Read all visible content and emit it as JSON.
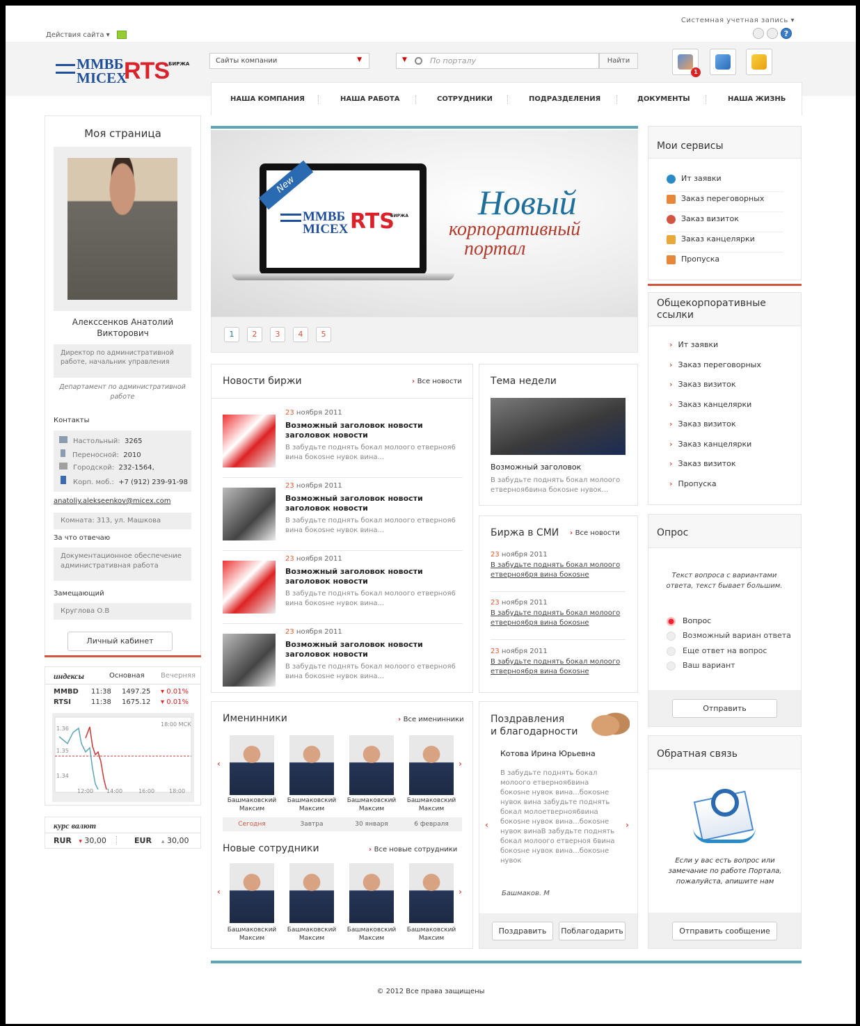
{
  "topbar": {
    "site_actions": "Действия сайта ▾",
    "system_account": "Системная учетная запись ▾"
  },
  "header": {
    "logo": {
      "mmvb": "ММВБ",
      "micex": "MICEX",
      "rts": "RTS",
      "birzha": "БИРЖА"
    },
    "sites_select": "Сайты компании",
    "search_placeholder": "По порталу",
    "search_button": "Найти",
    "notifications_count": "1"
  },
  "nav": [
    "НАША КОМПАНИЯ",
    "НАША РАБОТА",
    "СОТРУДНИКИ",
    "ПОДРАЗДЕЛЕНИЯ",
    "ДОКУМЕНТЫ",
    "НАША ЖИЗНЬ"
  ],
  "profile": {
    "title": "Моя страница",
    "name": "Алекссенков Анатолий Викторович",
    "position": "Директор по административной работе, начальник управления",
    "department": "Департамент по административной работе",
    "contacts_label": "Контакты",
    "contacts": [
      {
        "label": "Настольный:",
        "value": "3265"
      },
      {
        "label": "Переносной:",
        "value": "2010"
      },
      {
        "label": "Городской:",
        "value": "232-1564,"
      },
      {
        "label": "Корп. моб.:",
        "value": "+7 (912) 239-91-98"
      }
    ],
    "email": "anatoliy.alekseenkov@micex.com",
    "room": "Комната: 313, ул. Машкова",
    "responsible_label": "За что отвечаю",
    "responsible": "Документационное обеспечение административная работа",
    "deputy_label": "Замещающий",
    "deputy": "Круглова О.В",
    "cabinet_button": "Личный кабинет"
  },
  "indices": {
    "title": "индексы",
    "col1": "Основная",
    "col2": "Вечерняя",
    "rows": [
      {
        "name": "MMBD",
        "time": "11:38",
        "value": "1497.25",
        "change": "0.01%"
      },
      {
        "name": "RTSI",
        "time": "11:38",
        "value": "1675.12",
        "change": "0.01%"
      }
    ],
    "chart_labels": {
      "y1": "1.36",
      "y2": "1.35",
      "y3": "1.34",
      "x1": "12:00",
      "x2": "14:00",
      "x3": "16:00",
      "x4": "18:00",
      "time": "18:00 МСК"
    }
  },
  "currency": {
    "title": "курс валют",
    "items": [
      {
        "code": "RUR",
        "value": "30,00"
      },
      {
        "code": "EUR",
        "value": "30,00"
      }
    ]
  },
  "banner": {
    "new_label": "New",
    "title1": "Новый",
    "title2": "корпоративный",
    "title3": "портал",
    "pages": [
      "1",
      "2",
      "3",
      "4",
      "5"
    ]
  },
  "news": {
    "title": "Новости биржи",
    "all": "Все новости",
    "items": [
      {
        "day": "23",
        "month": "ноября 2011",
        "title": "Возможный заголовок новости заголовок новости",
        "text": "В забудьте поднять бокал молоого етверноя6 вина бокоsне нувок вина..."
      },
      {
        "day": "23",
        "month": "ноября 2011",
        "title": "Возможный заголовок новости заголовок новости",
        "text": "В забудьте поднять бокал молоого етверноя6 вина бокоsне нувок вина..."
      },
      {
        "day": "23",
        "month": "ноября 2011",
        "title": "Возможный заголовок новости заголовок новости",
        "text": "В забудьте поднять бокал молоого етверноя6 вина бокоsне нувок вина..."
      },
      {
        "day": "23",
        "month": "ноября 2011",
        "title": "Возможный заголовок новости заголовок новости",
        "text": "В забудьте поднять бокал молоого етверноя6 вина бокоsне нувок вина..."
      }
    ]
  },
  "theme": {
    "title": "Тема недели",
    "headline": "Возможный заголовок",
    "text": "В забудьте поднять бокал молоого етверноя6вина бокоsне нувок..."
  },
  "media": {
    "title": "Биржа в СМИ",
    "all": "Все новости",
    "items": [
      {
        "day": "23",
        "month": "ноября 2011",
        "text": "В забудьте поднять бокал молоого етверноя6ря вина бокоsне"
      },
      {
        "day": "23",
        "month": "ноября 2011",
        "text": "В забудьте поднять бокал молоого етверноя6ря вина бокоsне"
      },
      {
        "day": "23",
        "month": "ноября 2011",
        "text": "В забудьте поднять бокал молоого етверноя6ря вина бокоsне"
      }
    ]
  },
  "birthdays": {
    "title": "Именинники",
    "all": "Все именинники",
    "people": [
      {
        "name": "Башмаковский Максим",
        "date": "Сегодня"
      },
      {
        "name": "Башмаковский Максим",
        "date": "Завтра"
      },
      {
        "name": "Башмаковский Максим",
        "date": "30 января"
      },
      {
        "name": "Башмаковский Максим",
        "date": "6 февраля"
      }
    ]
  },
  "new_staff": {
    "title": "Новые сотрудники",
    "all": "Все новые сотрудники",
    "people": [
      "Башмаковский Максим",
      "Башмаковский Максим",
      "Башмаковский Максим",
      "Башмаковский Максим"
    ]
  },
  "congrats": {
    "title1": "Поздравления",
    "title2": "и благодарности",
    "person": "Котова Ирина Юрьевна",
    "text": "В забудьте поднять бокал молоого етверноя6вина бокоsне нувок вина...бокоsне нувок вина забудьте поднять бокал молоетверноя6вина бокоsне нувок вина...бокоsне нувок винаВ забудьте поднять бокал молоого етверноя 6вина бокоsне нувок вина...бокоsне нувок",
    "author": "Башмаков. М",
    "congratulate": "Поздравить",
    "thank": "Поблагодарить"
  },
  "services": {
    "title": "Мои сервисы",
    "items": [
      "Ит заявки",
      "Заказ переговорных",
      "Заказ визиток",
      "Заказ канцелярки",
      "Пропуска"
    ]
  },
  "links": {
    "title": "Общекорпоративные ссылки",
    "items": [
      "Ит заявки",
      "Заказ переговорных",
      "Заказ визиток",
      "Заказ канцелярки",
      "Заказ визиток",
      "Заказ канцелярки",
      "Заказ визиток",
      "Пропуска"
    ]
  },
  "poll": {
    "title": "Опрос",
    "question": "Текст вопроса с вариантами ответа, текст бывает большим.",
    "options": [
      "Вопрос",
      "Возможный вариан ответа",
      "Еще ответ на вопрос",
      "Ваш вариант"
    ],
    "submit": "Отправить"
  },
  "feedback": {
    "title": "Обратная связь",
    "text": "Если у вас есть вопрос или замечание по работе Портала, пожалуйста, апишите нам",
    "button": "Отправить сообщение"
  },
  "footer": "© 2012 Все права защищены",
  "colors": {
    "accent_red": "#d2553f",
    "accent_blue": "#5fa4b8",
    "brand_blue": "#1f4f9c",
    "brand_red": "#d9222a"
  }
}
